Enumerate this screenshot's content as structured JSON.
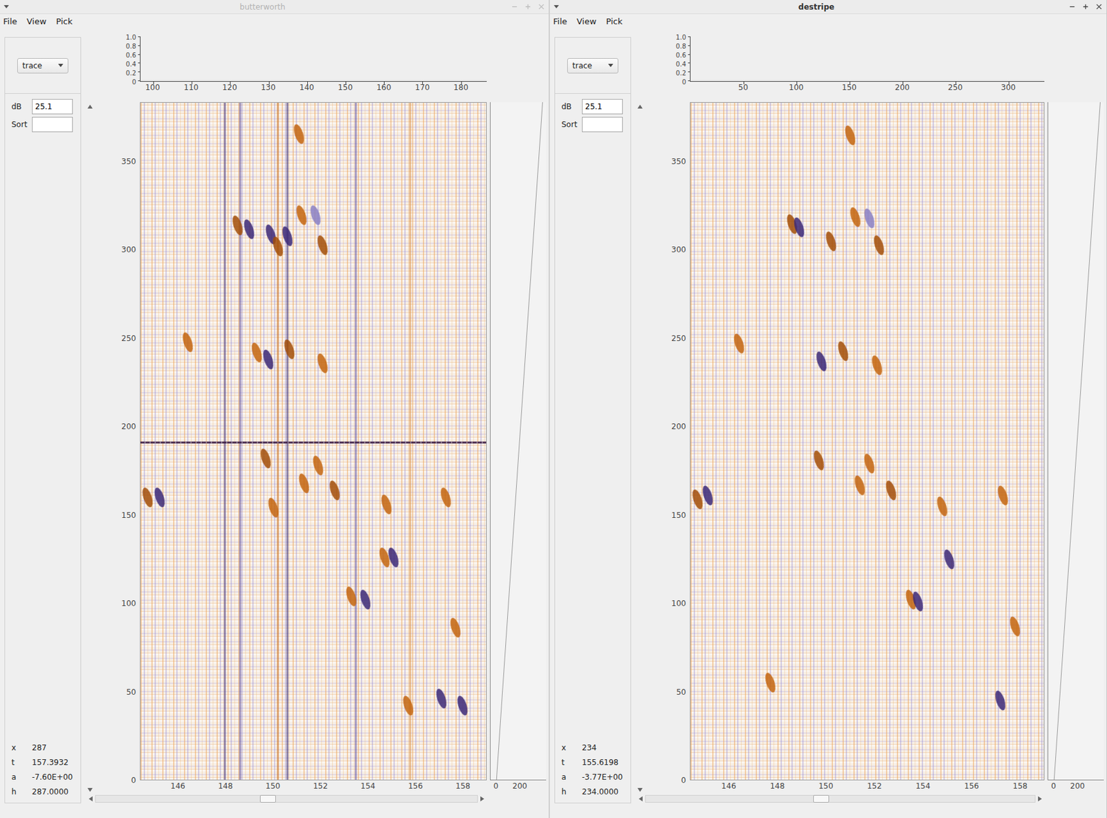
{
  "windows": [
    {
      "title": "butterworth",
      "active": false,
      "menu": [
        "File",
        "View",
        "Pick"
      ],
      "panel": {
        "dropdown": "trace",
        "fields": [
          {
            "label": "dB",
            "value": "25.1"
          },
          {
            "label": "Sort",
            "value": ""
          }
        ],
        "readout": [
          {
            "label": "x",
            "value": "287"
          },
          {
            "label": "t",
            "value": "157.3932"
          },
          {
            "label": "a",
            "value": "-7.60E+00"
          },
          {
            "label": "h",
            "value": "287.0000"
          }
        ]
      },
      "top_chart": {
        "y_range": [
          0,
          1
        ],
        "y_ticks": [
          {
            "label": "1.0",
            "value": 1.0
          },
          {
            "label": "0.8",
            "value": 0.8
          },
          {
            "label": "0.6",
            "value": 0.6
          },
          {
            "label": "0.4",
            "value": 0.4
          },
          {
            "label": "0.2",
            "value": 0.2
          },
          {
            "label": "0",
            "value": 0
          }
        ],
        "x_range": [
          96.7,
          186.7
        ],
        "x_ticks": [
          {
            "label": "100",
            "value": 100
          },
          {
            "label": "110",
            "value": 110
          },
          {
            "label": "120",
            "value": 120
          },
          {
            "label": "130",
            "value": 130
          },
          {
            "label": "140",
            "value": 140
          },
          {
            "label": "150",
            "value": 150
          },
          {
            "label": "160",
            "value": 160
          },
          {
            "label": "170",
            "value": 170
          },
          {
            "label": "180",
            "value": 180
          }
        ]
      },
      "section": {
        "y_range": [
          0,
          383.6
        ],
        "y_ticks": [
          {
            "label": "0",
            "value": 0
          },
          {
            "label": "50",
            "value": 50
          },
          {
            "label": "100",
            "value": 100
          },
          {
            "label": "150",
            "value": 150
          },
          {
            "label": "200",
            "value": 200
          },
          {
            "label": "250",
            "value": 250
          },
          {
            "label": "300",
            "value": 300
          },
          {
            "label": "350",
            "value": 350
          }
        ],
        "x_range": [
          144.4,
          159.0
        ],
        "x_ticks": [
          {
            "label": "146",
            "value": 146
          },
          {
            "label": "148",
            "value": 148
          },
          {
            "label": "150",
            "value": 150
          },
          {
            "label": "152",
            "value": 152
          },
          {
            "label": "154",
            "value": 154
          },
          {
            "label": "156",
            "value": 156
          },
          {
            "label": "158",
            "value": 158
          }
        ],
        "stripes": [
          {
            "kind": "vertical",
            "value": 147.95,
            "color": "#3b2877"
          },
          {
            "kind": "vertical",
            "value": 148.6,
            "color": "#5b4a9a"
          },
          {
            "kind": "vertical",
            "value": 150.2,
            "color": "#c4650f"
          },
          {
            "kind": "vertical",
            "value": 150.6,
            "color": "#2e1f6a"
          },
          {
            "kind": "vertical",
            "value": 153.5,
            "color": "#5b4a9a"
          },
          {
            "kind": "vertical",
            "value": 155.8,
            "color": "#d98a3a"
          },
          {
            "kind": "horizontal",
            "value": 191,
            "color": "#3a1a40"
          }
        ],
        "events": [
          {
            "trace": 151.1,
            "time": 366,
            "color": "#c4650f"
          },
          {
            "trace": 148.5,
            "time": 314,
            "color": "#a34e08"
          },
          {
            "trace": 149.0,
            "time": 312,
            "color": "#3b2877"
          },
          {
            "trace": 149.9,
            "time": 309,
            "color": "#3b2877"
          },
          {
            "trace": 150.2,
            "time": 302,
            "color": "#a34e08"
          },
          {
            "trace": 150.6,
            "time": 308,
            "color": "#3b2877"
          },
          {
            "trace": 151.2,
            "time": 320,
            "color": "#c4650f"
          },
          {
            "trace": 151.8,
            "time": 320,
            "color": "#8a80c4"
          },
          {
            "trace": 152.1,
            "time": 303,
            "color": "#a34e08"
          },
          {
            "trace": 149.3,
            "time": 242,
            "color": "#c4650f"
          },
          {
            "trace": 149.8,
            "time": 238,
            "color": "#3b2877"
          },
          {
            "trace": 150.7,
            "time": 244,
            "color": "#a34e08"
          },
          {
            "trace": 152.1,
            "time": 236,
            "color": "#c4650f"
          },
          {
            "trace": 146.4,
            "time": 248,
            "color": "#c4650f"
          },
          {
            "trace": 149.7,
            "time": 182,
            "color": "#a34e08"
          },
          {
            "trace": 151.9,
            "time": 178,
            "color": "#c4650f"
          },
          {
            "trace": 151.3,
            "time": 168,
            "color": "#c4650f"
          },
          {
            "trace": 152.6,
            "time": 164,
            "color": "#a34e08"
          },
          {
            "trace": 144.7,
            "time": 160,
            "color": "#a34e08"
          },
          {
            "trace": 145.2,
            "time": 160,
            "color": "#3b2877"
          },
          {
            "trace": 150.0,
            "time": 154,
            "color": "#c4650f"
          },
          {
            "trace": 154.8,
            "time": 156,
            "color": "#c4650f"
          },
          {
            "trace": 157.3,
            "time": 160,
            "color": "#c4650f"
          },
          {
            "trace": 155.1,
            "time": 126,
            "color": "#3b2877"
          },
          {
            "trace": 154.7,
            "time": 126,
            "color": "#c4650f"
          },
          {
            "trace": 153.9,
            "time": 102,
            "color": "#3b2877"
          },
          {
            "trace": 153.3,
            "time": 104,
            "color": "#c4650f"
          },
          {
            "trace": 157.7,
            "time": 86,
            "color": "#c4650f"
          },
          {
            "trace": 157.1,
            "time": 46,
            "color": "#3b2877"
          },
          {
            "trace": 158.0,
            "time": 42,
            "color": "#3b2877"
          },
          {
            "trace": 155.7,
            "time": 42,
            "color": "#c4650f"
          }
        ]
      },
      "strip": {
        "x_range": [
          -50,
          420
        ],
        "x_ticks": [
          {
            "label": "0",
            "value": 0
          },
          {
            "label": "200",
            "value": 200
          }
        ],
        "line": [
          0,
          390
        ]
      },
      "h_scroll": {
        "level": 0.43
      }
    },
    {
      "title": "destripe",
      "active": true,
      "menu": [
        "File",
        "View",
        "Pick"
      ],
      "panel": {
        "dropdown": "trace",
        "fields": [
          {
            "label": "dB",
            "value": "25.1"
          },
          {
            "label": "Sort",
            "value": ""
          }
        ],
        "readout": [
          {
            "label": "x",
            "value": "234"
          },
          {
            "label": "t",
            "value": "155.6198"
          },
          {
            "label": "a",
            "value": "-3.77E+00"
          },
          {
            "label": "h",
            "value": "234.0000"
          }
        ]
      },
      "top_chart": {
        "y_range": [
          0,
          1
        ],
        "y_ticks": [
          {
            "label": "1.0",
            "value": 1.0
          },
          {
            "label": "0.8",
            "value": 0.8
          },
          {
            "label": "0.6",
            "value": 0.6
          },
          {
            "label": "0.4",
            "value": 0.4
          },
          {
            "label": "0.2",
            "value": 0.2
          },
          {
            "label": "0",
            "value": 0
          }
        ],
        "x_range": [
          -0.3,
          334
        ],
        "x_ticks": [
          {
            "label": "50",
            "value": 50
          },
          {
            "label": "100",
            "value": 100
          },
          {
            "label": "150",
            "value": 150
          },
          {
            "label": "200",
            "value": 200
          },
          {
            "label": "250",
            "value": 250
          },
          {
            "label": "300",
            "value": 300
          }
        ]
      },
      "section": {
        "y_range": [
          0,
          383.6
        ],
        "y_ticks": [
          {
            "label": "0",
            "value": 0
          },
          {
            "label": "50",
            "value": 50
          },
          {
            "label": "100",
            "value": 100
          },
          {
            "label": "150",
            "value": 150
          },
          {
            "label": "200",
            "value": 200
          },
          {
            "label": "250",
            "value": 250
          },
          {
            "label": "300",
            "value": 300
          },
          {
            "label": "350",
            "value": 350
          }
        ],
        "x_range": [
          144.4,
          159.0
        ],
        "x_ticks": [
          {
            "label": "146",
            "value": 146
          },
          {
            "label": "148",
            "value": 148
          },
          {
            "label": "150",
            "value": 150
          },
          {
            "label": "152",
            "value": 152
          },
          {
            "label": "154",
            "value": 154
          },
          {
            "label": "156",
            "value": 156
          },
          {
            "label": "158",
            "value": 158
          }
        ],
        "stripes": [],
        "events": [
          {
            "trace": 151.0,
            "time": 365,
            "color": "#c4650f"
          },
          {
            "trace": 148.6,
            "time": 315,
            "color": "#a34e08"
          },
          {
            "trace": 148.9,
            "time": 313,
            "color": "#3b2877"
          },
          {
            "trace": 150.2,
            "time": 305,
            "color": "#a34e08"
          },
          {
            "trace": 151.2,
            "time": 319,
            "color": "#c4650f"
          },
          {
            "trace": 151.8,
            "time": 318,
            "color": "#8a80c4"
          },
          {
            "trace": 152.2,
            "time": 303,
            "color": "#a34e08"
          },
          {
            "trace": 149.8,
            "time": 237,
            "color": "#3b2877"
          },
          {
            "trace": 150.7,
            "time": 243,
            "color": "#a34e08"
          },
          {
            "trace": 152.1,
            "time": 235,
            "color": "#c4650f"
          },
          {
            "trace": 146.4,
            "time": 247,
            "color": "#c4650f"
          },
          {
            "trace": 149.7,
            "time": 181,
            "color": "#a34e08"
          },
          {
            "trace": 151.8,
            "time": 179,
            "color": "#c4650f"
          },
          {
            "trace": 151.4,
            "time": 167,
            "color": "#c4650f"
          },
          {
            "trace": 152.7,
            "time": 164,
            "color": "#a34e08"
          },
          {
            "trace": 144.7,
            "time": 159,
            "color": "#a34e08"
          },
          {
            "trace": 145.1,
            "time": 161,
            "color": "#3b2877"
          },
          {
            "trace": 154.8,
            "time": 155,
            "color": "#c4650f"
          },
          {
            "trace": 157.3,
            "time": 161,
            "color": "#c4650f"
          },
          {
            "trace": 155.1,
            "time": 125,
            "color": "#3b2877"
          },
          {
            "trace": 153.5,
            "time": 102,
            "color": "#c4650f"
          },
          {
            "trace": 153.8,
            "time": 101,
            "color": "#3b2877"
          },
          {
            "trace": 157.8,
            "time": 87,
            "color": "#c4650f"
          },
          {
            "trace": 157.2,
            "time": 45,
            "color": "#3b2877"
          },
          {
            "trace": 147.7,
            "time": 55,
            "color": "#c4650f"
          }
        ]
      },
      "strip": {
        "x_range": [
          -50,
          420
        ],
        "x_ticks": [
          {
            "label": "0",
            "value": 0
          },
          {
            "label": "200",
            "value": 200
          }
        ],
        "line": [
          0,
          390
        ]
      },
      "h_scroll": {
        "level": 0.43
      }
    }
  ]
}
